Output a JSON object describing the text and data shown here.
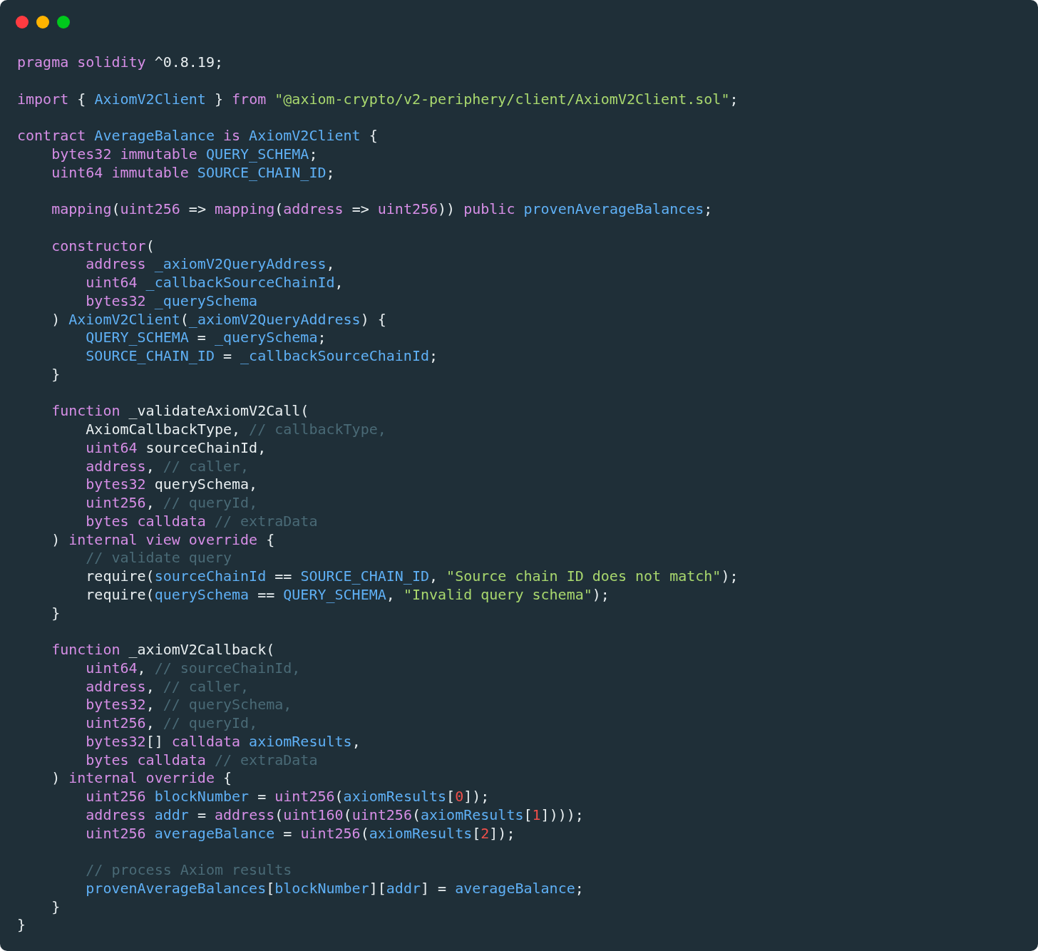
{
  "window": {
    "controls": [
      {
        "kind": "close"
      },
      {
        "kind": "minimize"
      },
      {
        "kind": "zoom"
      }
    ]
  },
  "code_lines": [
    {
      "kind": "code",
      "tokens": [
        {
          "kind": "kw",
          "text": "pragma solidity"
        },
        {
          "kind": "tx",
          "text": " ^0.8.19;"
        }
      ]
    },
    {
      "kind": "blank"
    },
    {
      "kind": "code",
      "tokens": [
        {
          "kind": "kw",
          "text": "import"
        },
        {
          "kind": "tx",
          "text": " { "
        },
        {
          "kind": "id",
          "text": "AxiomV2Client"
        },
        {
          "kind": "tx",
          "text": " } "
        },
        {
          "kind": "kw",
          "text": "from"
        },
        {
          "kind": "str",
          "text": " \"@axiom-crypto/v2-periphery/client/AxiomV2Client.sol\""
        },
        {
          "kind": "tx",
          "text": ";"
        }
      ]
    },
    {
      "kind": "blank"
    },
    {
      "kind": "code",
      "tokens": [
        {
          "kind": "kw",
          "text": "contract"
        },
        {
          "kind": "id",
          "text": " AverageBalance"
        },
        {
          "kind": "kw",
          "text": " is"
        },
        {
          "kind": "id",
          "text": " AxiomV2Client"
        },
        {
          "kind": "tx",
          "text": " {"
        }
      ]
    },
    {
      "kind": "code",
      "tokens": [
        {
          "kind": "kw",
          "text": "    bytes32 immutable"
        },
        {
          "kind": "id",
          "text": " QUERY_SCHEMA"
        },
        {
          "kind": "tx",
          "text": ";"
        }
      ]
    },
    {
      "kind": "code",
      "tokens": [
        {
          "kind": "kw",
          "text": "    uint64 immutable"
        },
        {
          "kind": "id",
          "text": " SOURCE_CHAIN_ID"
        },
        {
          "kind": "tx",
          "text": ";"
        }
      ]
    },
    {
      "kind": "blank"
    },
    {
      "kind": "code",
      "tokens": [
        {
          "kind": "kw",
          "text": "    mapping"
        },
        {
          "kind": "tx",
          "text": "("
        },
        {
          "kind": "kw",
          "text": "uint256"
        },
        {
          "kind": "tx",
          "text": " => "
        },
        {
          "kind": "kw",
          "text": "mapping"
        },
        {
          "kind": "tx",
          "text": "("
        },
        {
          "kind": "kw",
          "text": "address"
        },
        {
          "kind": "tx",
          "text": " => "
        },
        {
          "kind": "kw",
          "text": "uint256"
        },
        {
          "kind": "tx",
          "text": ")) "
        },
        {
          "kind": "kw",
          "text": "public"
        },
        {
          "kind": "id",
          "text": " provenAverageBalances"
        },
        {
          "kind": "tx",
          "text": ";"
        }
      ]
    },
    {
      "kind": "blank"
    },
    {
      "kind": "code",
      "tokens": [
        {
          "kind": "kw",
          "text": "    constructor"
        },
        {
          "kind": "tx",
          "text": "("
        }
      ]
    },
    {
      "kind": "code",
      "tokens": [
        {
          "kind": "kw",
          "text": "        address"
        },
        {
          "kind": "id",
          "text": " _axiomV2QueryAddress"
        },
        {
          "kind": "tx",
          "text": ","
        }
      ]
    },
    {
      "kind": "code",
      "tokens": [
        {
          "kind": "kw",
          "text": "        uint64"
        },
        {
          "kind": "id",
          "text": " _callbackSourceChainId"
        },
        {
          "kind": "tx",
          "text": ","
        }
      ]
    },
    {
      "kind": "code",
      "tokens": [
        {
          "kind": "kw",
          "text": "        bytes32"
        },
        {
          "kind": "id",
          "text": " _querySchema"
        }
      ]
    },
    {
      "kind": "code",
      "tokens": [
        {
          "kind": "tx",
          "text": "    ) "
        },
        {
          "kind": "id",
          "text": "AxiomV2Client"
        },
        {
          "kind": "tx",
          "text": "("
        },
        {
          "kind": "id",
          "text": "_axiomV2QueryAddress"
        },
        {
          "kind": "tx",
          "text": ") {"
        }
      ]
    },
    {
      "kind": "code",
      "tokens": [
        {
          "kind": "id",
          "text": "        QUERY_SCHEMA"
        },
        {
          "kind": "tx",
          "text": " = "
        },
        {
          "kind": "id",
          "text": "_querySchema"
        },
        {
          "kind": "tx",
          "text": ";"
        }
      ]
    },
    {
      "kind": "code",
      "tokens": [
        {
          "kind": "id",
          "text": "        SOURCE_CHAIN_ID"
        },
        {
          "kind": "tx",
          "text": " = "
        },
        {
          "kind": "id",
          "text": "_callbackSourceChainId"
        },
        {
          "kind": "tx",
          "text": ";"
        }
      ]
    },
    {
      "kind": "code",
      "tokens": [
        {
          "kind": "tx",
          "text": "    }"
        }
      ]
    },
    {
      "kind": "blank"
    },
    {
      "kind": "code",
      "tokens": [
        {
          "kind": "kw",
          "text": "    function"
        },
        {
          "kind": "tx",
          "text": " _validateAxiomV2Call("
        }
      ]
    },
    {
      "kind": "code",
      "tokens": [
        {
          "kind": "tx",
          "text": "        AxiomCallbackType, "
        },
        {
          "kind": "cm",
          "text": "// callbackType,"
        }
      ]
    },
    {
      "kind": "code",
      "tokens": [
        {
          "kind": "kw",
          "text": "        uint64"
        },
        {
          "kind": "tx",
          "text": " sourceChainId,"
        }
      ]
    },
    {
      "kind": "code",
      "tokens": [
        {
          "kind": "kw",
          "text": "        address"
        },
        {
          "kind": "tx",
          "text": ", "
        },
        {
          "kind": "cm",
          "text": "// caller,"
        }
      ]
    },
    {
      "kind": "code",
      "tokens": [
        {
          "kind": "kw",
          "text": "        bytes32"
        },
        {
          "kind": "tx",
          "text": " querySchema,"
        }
      ]
    },
    {
      "kind": "code",
      "tokens": [
        {
          "kind": "kw",
          "text": "        uint256"
        },
        {
          "kind": "tx",
          "text": ", "
        },
        {
          "kind": "cm",
          "text": "// queryId,"
        }
      ]
    },
    {
      "kind": "code",
      "tokens": [
        {
          "kind": "kw",
          "text": "        bytes calldata"
        },
        {
          "kind": "cm",
          "text": " // extraData"
        }
      ]
    },
    {
      "kind": "code",
      "tokens": [
        {
          "kind": "tx",
          "text": "    ) "
        },
        {
          "kind": "kw",
          "text": "internal view override"
        },
        {
          "kind": "tx",
          "text": " {"
        }
      ]
    },
    {
      "kind": "code",
      "tokens": [
        {
          "kind": "cm",
          "text": "        // validate query"
        }
      ]
    },
    {
      "kind": "code",
      "tokens": [
        {
          "kind": "tx",
          "text": "        require("
        },
        {
          "kind": "id",
          "text": "sourceChainId"
        },
        {
          "kind": "tx",
          "text": " == "
        },
        {
          "kind": "id",
          "text": "SOURCE_CHAIN_ID"
        },
        {
          "kind": "tx",
          "text": ", "
        },
        {
          "kind": "str",
          "text": "\"Source chain ID does not match\""
        },
        {
          "kind": "tx",
          "text": ");"
        }
      ]
    },
    {
      "kind": "code",
      "tokens": [
        {
          "kind": "tx",
          "text": "        require("
        },
        {
          "kind": "id",
          "text": "querySchema"
        },
        {
          "kind": "tx",
          "text": " == "
        },
        {
          "kind": "id",
          "text": "QUERY_SCHEMA"
        },
        {
          "kind": "tx",
          "text": ", "
        },
        {
          "kind": "str",
          "text": "\"Invalid query schema\""
        },
        {
          "kind": "tx",
          "text": ");"
        }
      ]
    },
    {
      "kind": "code",
      "tokens": [
        {
          "kind": "tx",
          "text": "    }"
        }
      ]
    },
    {
      "kind": "blank"
    },
    {
      "kind": "code",
      "tokens": [
        {
          "kind": "kw",
          "text": "    function"
        },
        {
          "kind": "tx",
          "text": " _axiomV2Callback("
        }
      ]
    },
    {
      "kind": "code",
      "tokens": [
        {
          "kind": "kw",
          "text": "        uint64"
        },
        {
          "kind": "tx",
          "text": ", "
        },
        {
          "kind": "cm",
          "text": "// sourceChainId,"
        }
      ]
    },
    {
      "kind": "code",
      "tokens": [
        {
          "kind": "kw",
          "text": "        address"
        },
        {
          "kind": "tx",
          "text": ", "
        },
        {
          "kind": "cm",
          "text": "// caller,"
        }
      ]
    },
    {
      "kind": "code",
      "tokens": [
        {
          "kind": "kw",
          "text": "        bytes32"
        },
        {
          "kind": "tx",
          "text": ", "
        },
        {
          "kind": "cm",
          "text": "// querySchema,"
        }
      ]
    },
    {
      "kind": "code",
      "tokens": [
        {
          "kind": "kw",
          "text": "        uint256"
        },
        {
          "kind": "tx",
          "text": ", "
        },
        {
          "kind": "cm",
          "text": "// queryId,"
        }
      ]
    },
    {
      "kind": "code",
      "tokens": [
        {
          "kind": "kw",
          "text": "        bytes32"
        },
        {
          "kind": "tx",
          "text": "[] "
        },
        {
          "kind": "kw",
          "text": "calldata"
        },
        {
          "kind": "id",
          "text": " axiomResults"
        },
        {
          "kind": "tx",
          "text": ","
        }
      ]
    },
    {
      "kind": "code",
      "tokens": [
        {
          "kind": "kw",
          "text": "        bytes calldata"
        },
        {
          "kind": "cm",
          "text": " // extraData"
        }
      ]
    },
    {
      "kind": "code",
      "tokens": [
        {
          "kind": "tx",
          "text": "    ) "
        },
        {
          "kind": "kw",
          "text": "internal override"
        },
        {
          "kind": "tx",
          "text": " {"
        }
      ]
    },
    {
      "kind": "code",
      "tokens": [
        {
          "kind": "kw",
          "text": "        uint256"
        },
        {
          "kind": "id",
          "text": " blockNumber"
        },
        {
          "kind": "tx",
          "text": " = "
        },
        {
          "kind": "kw",
          "text": "uint256"
        },
        {
          "kind": "tx",
          "text": "("
        },
        {
          "kind": "id",
          "text": "axiomResults"
        },
        {
          "kind": "tx",
          "text": "["
        },
        {
          "kind": "num",
          "text": "0"
        },
        {
          "kind": "tx",
          "text": "]);"
        }
      ]
    },
    {
      "kind": "code",
      "tokens": [
        {
          "kind": "kw",
          "text": "        address"
        },
        {
          "kind": "id",
          "text": " addr"
        },
        {
          "kind": "tx",
          "text": " = "
        },
        {
          "kind": "kw",
          "text": "address"
        },
        {
          "kind": "tx",
          "text": "("
        },
        {
          "kind": "kw",
          "text": "uint160"
        },
        {
          "kind": "tx",
          "text": "("
        },
        {
          "kind": "kw",
          "text": "uint256"
        },
        {
          "kind": "tx",
          "text": "("
        },
        {
          "kind": "id",
          "text": "axiomResults"
        },
        {
          "kind": "tx",
          "text": "["
        },
        {
          "kind": "num",
          "text": "1"
        },
        {
          "kind": "tx",
          "text": "])));"
        }
      ]
    },
    {
      "kind": "code",
      "tokens": [
        {
          "kind": "kw",
          "text": "        uint256"
        },
        {
          "kind": "id",
          "text": " averageBalance"
        },
        {
          "kind": "tx",
          "text": " = "
        },
        {
          "kind": "kw",
          "text": "uint256"
        },
        {
          "kind": "tx",
          "text": "("
        },
        {
          "kind": "id",
          "text": "axiomResults"
        },
        {
          "kind": "tx",
          "text": "["
        },
        {
          "kind": "num",
          "text": "2"
        },
        {
          "kind": "tx",
          "text": "]);"
        }
      ]
    },
    {
      "kind": "blank"
    },
    {
      "kind": "code",
      "tokens": [
        {
          "kind": "cm",
          "text": "        // process Axiom results"
        }
      ]
    },
    {
      "kind": "code",
      "tokens": [
        {
          "kind": "id",
          "text": "        provenAverageBalances"
        },
        {
          "kind": "tx",
          "text": "["
        },
        {
          "kind": "id",
          "text": "blockNumber"
        },
        {
          "kind": "tx",
          "text": "]["
        },
        {
          "kind": "id",
          "text": "addr"
        },
        {
          "kind": "tx",
          "text": "] = "
        },
        {
          "kind": "id",
          "text": "averageBalance"
        },
        {
          "kind": "tx",
          "text": ";"
        }
      ]
    },
    {
      "kind": "code",
      "tokens": [
        {
          "kind": "tx",
          "text": "    }"
        }
      ]
    },
    {
      "kind": "code",
      "tokens": [
        {
          "kind": "tx",
          "text": "}"
        }
      ]
    }
  ]
}
